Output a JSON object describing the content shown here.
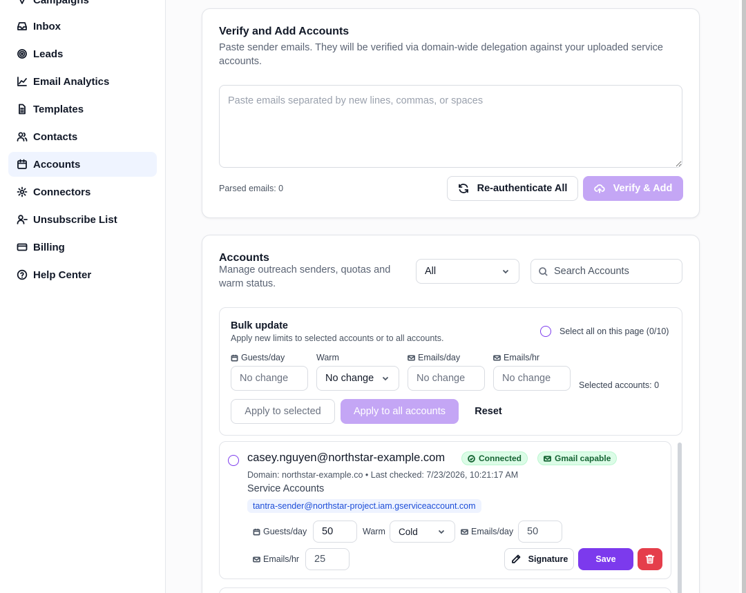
{
  "sidebar": {
    "items": [
      {
        "label": "Campaigns",
        "icon": "campaigns-icon"
      },
      {
        "label": "Inbox",
        "icon": "inbox-icon"
      },
      {
        "label": "Leads",
        "icon": "target-icon"
      },
      {
        "label": "Email Analytics",
        "icon": "chart-line-icon"
      },
      {
        "label": "Templates",
        "icon": "document-icon"
      },
      {
        "label": "Contacts",
        "icon": "users-icon"
      },
      {
        "label": "Accounts",
        "icon": "calendar-icon",
        "active": true
      },
      {
        "label": "Connectors",
        "icon": "gear-icon"
      },
      {
        "label": "Unsubscribe List",
        "icon": "user-minus-icon"
      },
      {
        "label": "Billing",
        "icon": "credit-card-icon"
      },
      {
        "label": "Help Center",
        "icon": "help-circle-icon"
      }
    ]
  },
  "verify": {
    "title": "Verify and Add Accounts",
    "subtitle": "Paste sender emails. They will be verified via domain-wide delegation against your uploaded service accounts.",
    "placeholder": "Paste emails separated by new lines, commas, or spaces",
    "parsed": "Parsed emails: 0",
    "reauth_label": "Re-authenticate All",
    "verify_label": "Verify & Add"
  },
  "accounts": {
    "title": "Accounts",
    "subtitle": "Manage outreach senders, quotas and warm status.",
    "filter_value": "All",
    "search_placeholder": "Search Accounts"
  },
  "bulk": {
    "title": "Bulk update",
    "subtitle": "Apply new limits to selected accounts or to all accounts.",
    "select_all": "Select all on this page (0/10)",
    "guests_label": "Guests/day",
    "warm_label": "Warm",
    "emails_day_label": "Emails/day",
    "emails_hr_label": "Emails/hr",
    "no_change": "No change",
    "selected_count": "Selected accounts: 0",
    "apply_selected": "Apply to selected",
    "apply_all": "Apply to all accounts",
    "reset": "Reset"
  },
  "account_row": {
    "email": "casey.nguyen@northstar-example.com",
    "status": "Connected",
    "capability": "Gmail capable",
    "meta": "Domain: northstar-example.co • Last checked: 7/23/2026, 10:21:17 AM",
    "service_title": "Service Accounts",
    "service_email": "tantra-sender@northstar-project.iam.gserviceaccount.com",
    "guests_label": "Guests/day",
    "guests_value": "50",
    "warm_label": "Warm",
    "warm_value": "Cold",
    "emails_day_label": "Emails/day",
    "emails_day_value": "50",
    "emails_hr_label": "Emails/hr",
    "emails_hr_value": "25",
    "signature_label": "Signature",
    "save_label": "Save"
  },
  "colors": {
    "accent": "#7c3aed",
    "accent_light": "#c4a6f5",
    "danger": "#e53e4b",
    "active_nav": "#eff4ff"
  }
}
